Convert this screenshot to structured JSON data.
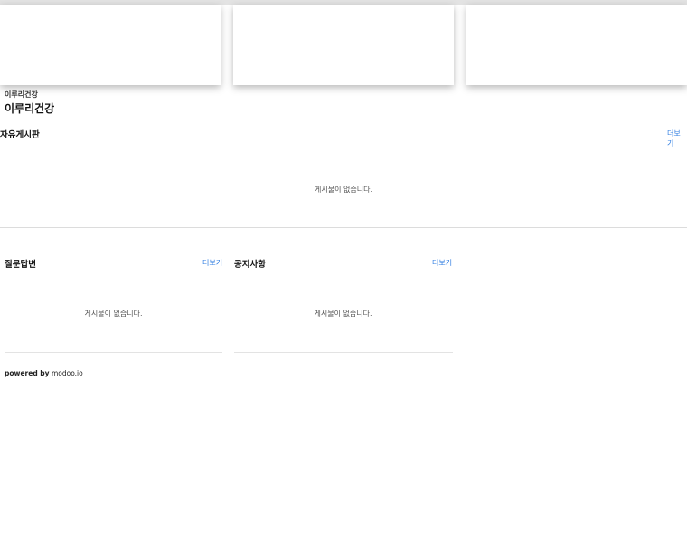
{
  "site": {
    "brand_small": "이루리건강",
    "brand_title": "이루리건강"
  },
  "boards": {
    "free": {
      "title": "자유게시판",
      "more": "더보기",
      "empty": "게시물이 없습니다."
    },
    "qa": {
      "title": "질문답변",
      "more": "더보기",
      "empty": "게시물이 없습니다."
    },
    "notice": {
      "title": "공지사항",
      "more": "더보기",
      "empty": "게시물이 없습니다."
    }
  },
  "footer": {
    "powered": "powered by",
    "brand": "modoo.io"
  },
  "colors": {
    "accent": "#2f7de1",
    "divider": "#dcdcdc",
    "topbar": "#e3e3e3"
  }
}
